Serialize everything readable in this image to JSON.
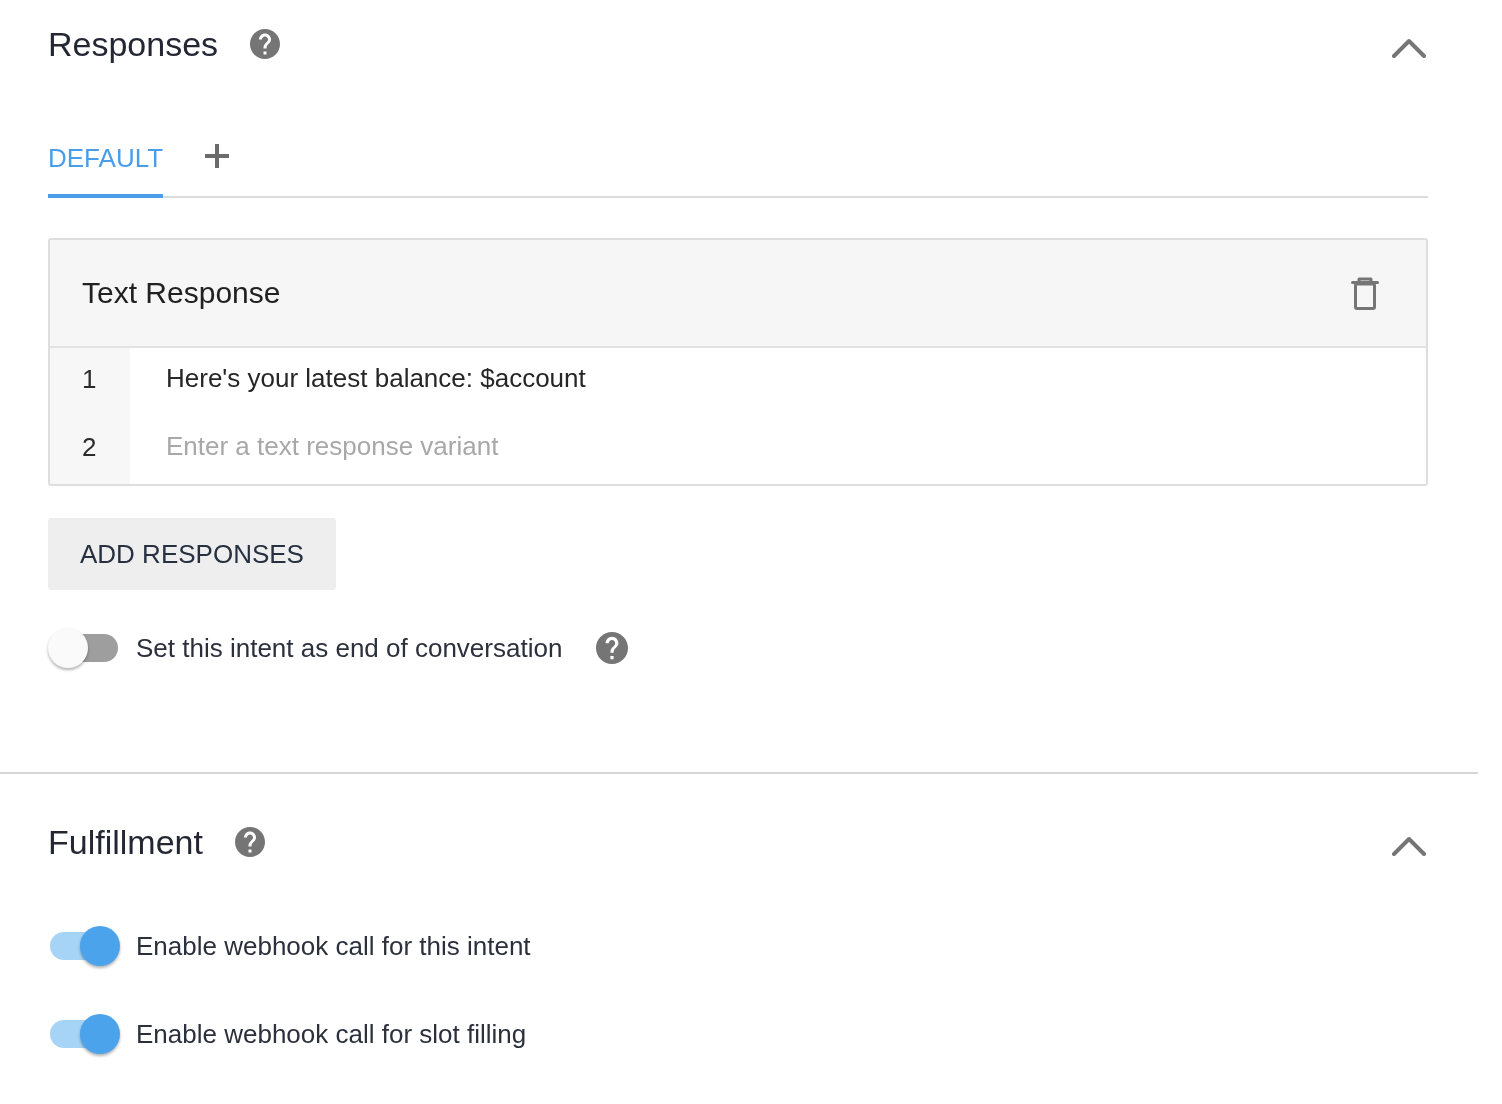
{
  "responses": {
    "title": "Responses",
    "help": true,
    "expanded": true,
    "tabs": [
      {
        "label": "DEFAULT",
        "selected": true
      }
    ],
    "card": {
      "title": "Text Response",
      "rows": [
        {
          "number": "1",
          "value": "Here's your latest balance: $account"
        },
        {
          "number": "2",
          "placeholder": "Enter a text response variant"
        }
      ]
    },
    "add_button": "ADD RESPONSES",
    "toggles": [
      {
        "label": "Set this intent as end of conversation",
        "on": false,
        "help": true
      }
    ]
  },
  "fulfillment": {
    "title": "Fulfillment",
    "help": true,
    "expanded": true,
    "toggles": [
      {
        "label": "Enable webhook call for this intent",
        "on": true,
        "help": false
      },
      {
        "label": "Enable webhook call for slot filling",
        "on": true,
        "help": false
      }
    ]
  }
}
